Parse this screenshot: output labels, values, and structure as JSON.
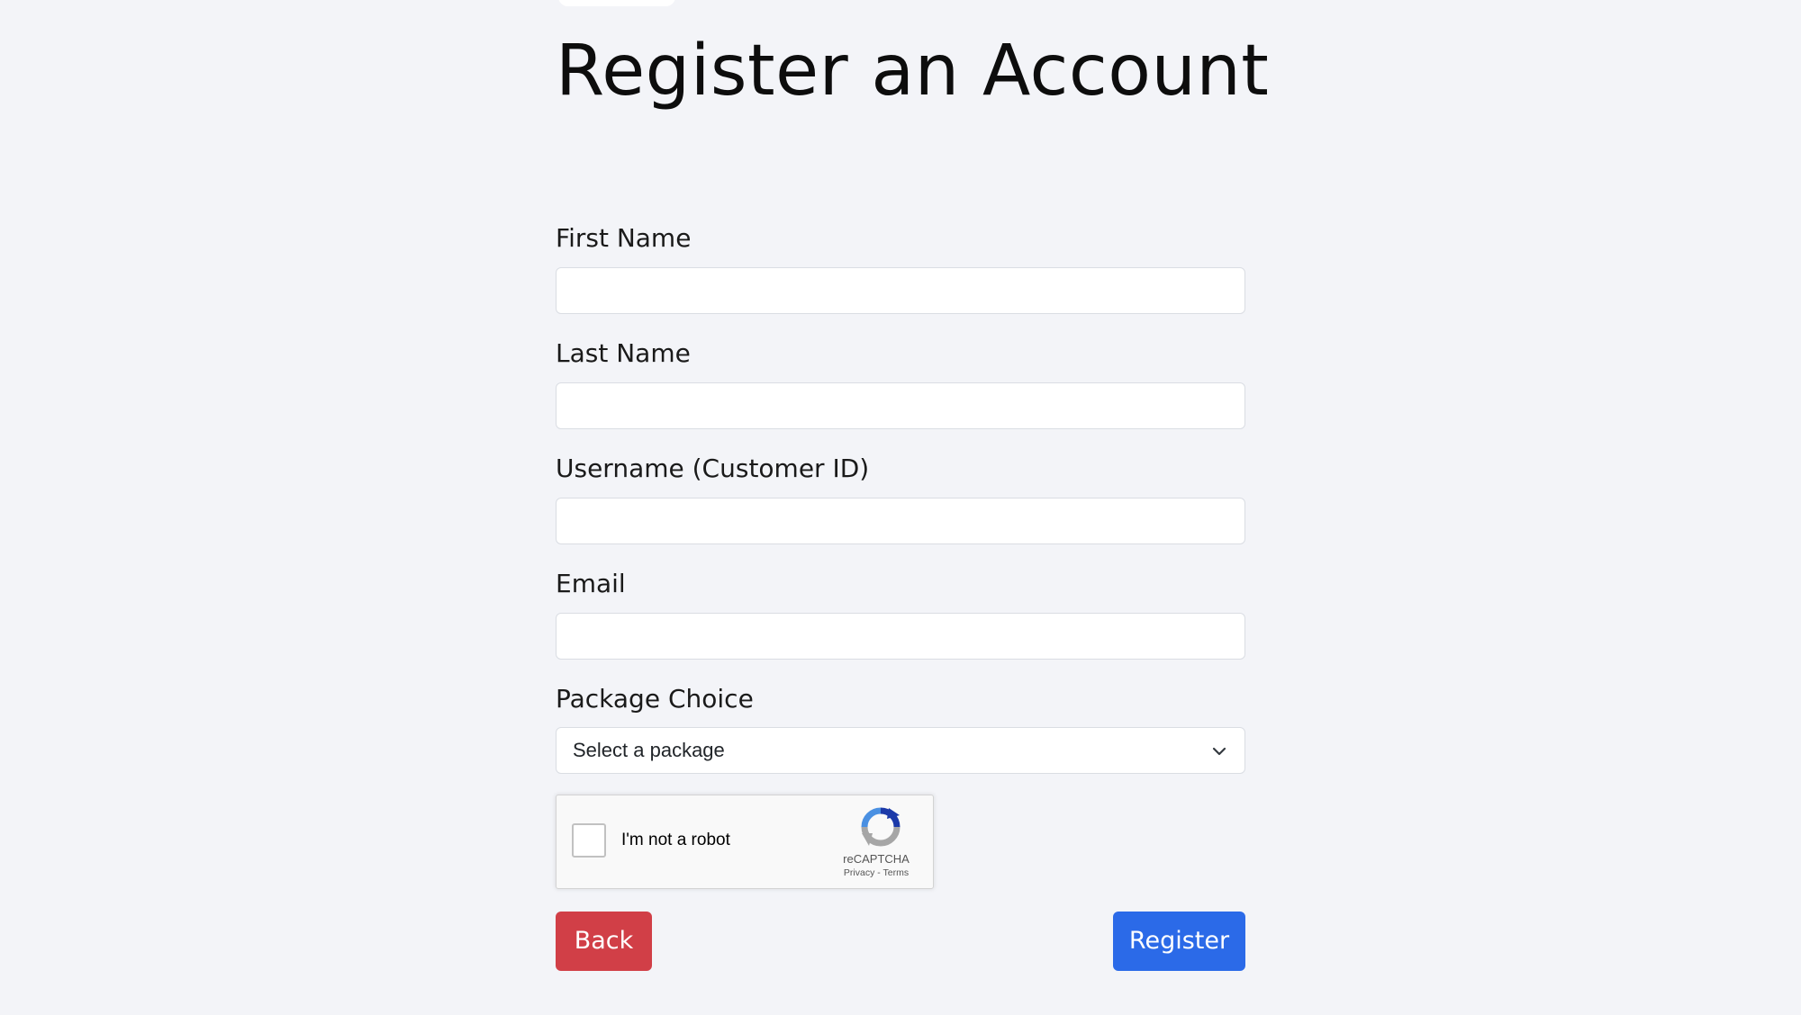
{
  "page": {
    "title": "Register an Account"
  },
  "form": {
    "first_name": {
      "label": "First Name",
      "value": "",
      "placeholder": ""
    },
    "last_name": {
      "label": "Last Name",
      "value": "",
      "placeholder": ""
    },
    "username": {
      "label": "Username (Customer ID)",
      "value": "",
      "placeholder": ""
    },
    "email": {
      "label": "Email",
      "value": "",
      "placeholder": ""
    },
    "package": {
      "label": "Package Choice",
      "selected": "Select a package"
    }
  },
  "captcha": {
    "label": "I'm not a robot",
    "brand": "reCAPTCHA",
    "privacy": "Privacy",
    "separator": " - ",
    "terms": "Terms",
    "icon": "recaptcha-logo-icon"
  },
  "actions": {
    "back_label": "Back",
    "register_label": "Register"
  },
  "colors": {
    "background": "#f3f4f8",
    "back_button": "#d13f47",
    "register_button": "#2b6ae8"
  }
}
